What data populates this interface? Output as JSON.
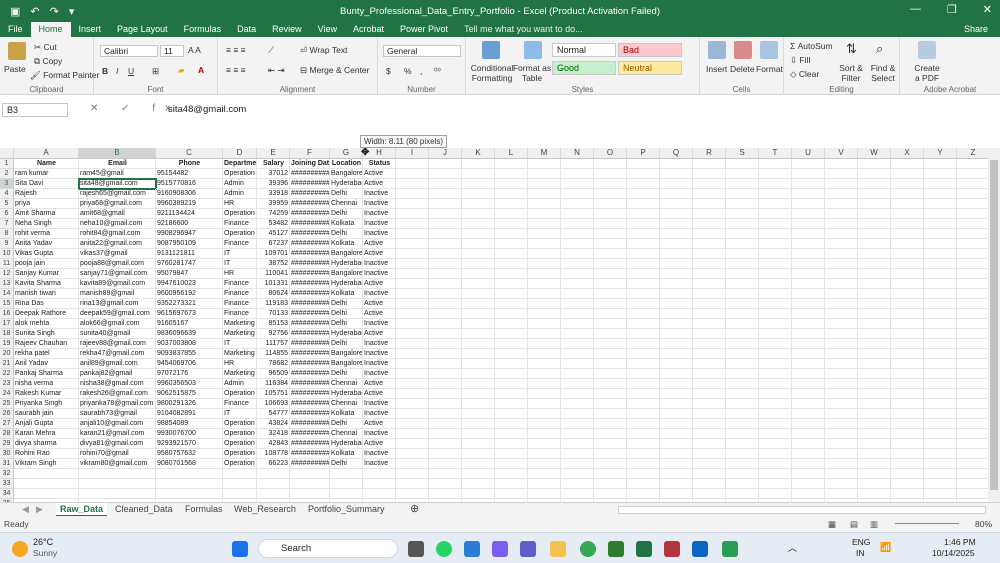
{
  "window": {
    "title": "Bunty_Professional_Data_Entry_Portfolio - Excel (Product Activation Failed)",
    "controls": [
      "—",
      "❐",
      "✕"
    ]
  },
  "menu": {
    "tabs": [
      "File",
      "Home",
      "Insert",
      "Page Layout",
      "Formulas",
      "Data",
      "Review",
      "View",
      "Acrobat",
      "Power Pivot"
    ],
    "search_text": "Tell me what you want to do...",
    "share": "Share"
  },
  "ribbon": {
    "clipboard": {
      "paste": "Paste",
      "cut": "Cut",
      "copy": "Copy",
      "format_painter": "Format Painter",
      "group": "Clipboard"
    },
    "font": {
      "name": "Calibri",
      "size": "11",
      "group": "Font",
      "bold": "B",
      "italic": "I",
      "underline": "U"
    },
    "alignment": {
      "wrap": "Wrap Text",
      "merge": "Merge & Center",
      "group": "Alignment"
    },
    "number": {
      "format": "General",
      "currency": "$",
      "percent": "%",
      "comma": ",",
      "group": "Number"
    },
    "styles": {
      "conditional": "Conditional Formatting",
      "table": "Format as Table",
      "normal": "Normal",
      "bad": "Bad",
      "good": "Good",
      "neutral": "Neutral",
      "group": "Styles"
    },
    "cells": {
      "insert": "Insert",
      "delete": "Delete",
      "format": "Format",
      "group": "Cells"
    },
    "editing": {
      "autosum": "AutoSum",
      "fill": "Fill",
      "clear": "Clear",
      "sort": "Sort & Filter",
      "find": "Find & Select",
      "group": "Editing"
    },
    "adobe": {
      "create": "Create a PDF",
      "group": "Adobe Acrobat"
    }
  },
  "formula_bar": {
    "name_box": "B3",
    "fx": "✕ ✓ fx",
    "value": "sita48@gmail.com"
  },
  "tooltip": "Width: 8.11 (80 pixels)",
  "sheet": {
    "columns": [
      "A",
      "B",
      "C",
      "D",
      "E",
      "F",
      "G",
      "H",
      "I",
      "J",
      "K",
      "L",
      "M",
      "N",
      "O",
      "P",
      "Q",
      "R",
      "S",
      "T",
      "U",
      "V",
      "W",
      "X",
      "Y",
      "Z"
    ],
    "headers": [
      "Name",
      "Email",
      "Phone",
      "Department",
      "Salary",
      "Joining Date",
      "Location",
      "Status"
    ],
    "rows": [
      [
        "ram kumar",
        "ram45@gmail",
        "95154482",
        "Operation",
        "37012",
        "##########",
        "Bangalore",
        "Active"
      ],
      [
        "Sita Davi",
        "sita48@gmail.com",
        "9515770816",
        "Admin",
        "39396",
        "##########",
        "Hyderabad",
        "Active"
      ],
      [
        "Rajesh",
        "rajesh65@gmail.com",
        "9160908306",
        "Admin",
        "33918",
        "##########",
        "Delhi",
        "Inactive"
      ],
      [
        "priya",
        "priya68@gmail.com",
        "9960389219",
        "HR",
        "39959",
        "##########",
        "Chennai",
        "Inactive"
      ],
      [
        "Amit Sharma",
        "amit68@gmail",
        "9211134424",
        "Operation",
        "74259",
        "##########",
        "Delhi",
        "Inactive"
      ],
      [
        "Neha Singh",
        "neha10@gmail.com",
        "92186600",
        "Finance",
        "53482",
        "##########",
        "Kolkata",
        "Inactive"
      ],
      [
        "rohit verma",
        "rohit84@gmail.com",
        "9908296947",
        "Operation",
        "45127",
        "##########",
        "Delhi",
        "Inactive"
      ],
      [
        "Anita Yadav",
        "anita22@gmail.com",
        "9087950109",
        "Finance",
        "67237",
        "##########",
        "Kolkata",
        "Active"
      ],
      [
        "Vikas Gupta",
        "vikas37@gmail",
        "9131121811",
        "IT",
        "109701",
        "##########",
        "Bangalore",
        "Active"
      ],
      [
        "pooja jain",
        "pooja88@gmail.com",
        "9760281747",
        "IT",
        "38752",
        "##########",
        "Hyderabad",
        "Inactive"
      ],
      [
        "Sanjay Kumar",
        "sanjay71@gmail.com",
        "95079847",
        "HR",
        "110041",
        "##########",
        "Bangalore",
        "Inactive"
      ],
      [
        "Kavita Sharma",
        "kavita89@gmail.com",
        "9947610023",
        "Finance",
        "101331",
        "##########",
        "Hyderabad",
        "Active"
      ],
      [
        "manish tiwari",
        "manish89@gmail",
        "9600956192",
        "Finance",
        "80624",
        "##########",
        "Kolkata",
        "Inactive"
      ],
      [
        "Rina Das",
        "rina13@gmail.com",
        "9352273321",
        "Finance",
        "119183",
        "##########",
        "Delhi",
        "Active"
      ],
      [
        "Deepak Rathore",
        "deepak59@gmail.com",
        "9615697673",
        "Finance",
        "70133",
        "##########",
        "Delhi",
        "Active"
      ],
      [
        "alok mehta",
        "alok66@gmail.com",
        "91605167",
        "Marketing",
        "85153",
        "##########",
        "Delhi",
        "Inactive"
      ],
      [
        "Sunita Singh",
        "sunita40@gmail",
        "9836096639",
        "Marketing",
        "92756",
        "##########",
        "Hyderabad",
        "Active"
      ],
      [
        "Rajeev Chauhan",
        "rajeev88@gmail.com",
        "9037003808",
        "IT",
        "111757",
        "##########",
        "Delhi",
        "Inactive"
      ],
      [
        "rekha patel",
        "rekha47@gmail.com",
        "9093837855",
        "Marketing",
        "114855",
        "##########",
        "Bangalore",
        "Inactive"
      ],
      [
        "Anil Yadav",
        "anil89@gmail.com",
        "9454069706",
        "HR",
        "78682",
        "##########",
        "Bangalore",
        "Inactive"
      ],
      [
        "Pankaj Sharma",
        "pankaj82@gmail",
        "97072176",
        "Marketing",
        "96509",
        "##########",
        "Delhi",
        "Inactive"
      ],
      [
        "nisha verma",
        "nisha38@gmail.com",
        "9960356503",
        "Admin",
        "116384",
        "##########",
        "Chennai",
        "Active"
      ],
      [
        "Rakesh Kumar",
        "rakesh26@gmail.com",
        "9062515875",
        "Operation",
        "105751",
        "##########",
        "Hyderabad",
        "Active"
      ],
      [
        "Priyanka Singh",
        "priyanka78@gmail.com",
        "9800291326",
        "Finance",
        "106693",
        "##########",
        "Chennai",
        "Inactive"
      ],
      [
        "saurabh jain",
        "saurabh73@gmail",
        "9104082891",
        "IT",
        "54777",
        "##########",
        "Kolkata",
        "Inactive"
      ],
      [
        "Anjali Gupta",
        "anjali10@gmail.com",
        "98854089",
        "Operation",
        "43824",
        "##########",
        "Delhi",
        "Active"
      ],
      [
        "Karan Mehra",
        "karan21@gmail.com",
        "9930076700",
        "Operation",
        "32418",
        "##########",
        "Chennai",
        "Inactive"
      ],
      [
        "divya sharma",
        "divya81@gmail.com",
        "9293921570",
        "Operation",
        "42843",
        "##########",
        "Hyderabad",
        "Active"
      ],
      [
        "Rohini Rao",
        "rohini70@gmail",
        "9580757632",
        "Operation",
        "108778",
        "##########",
        "Kolkata",
        "Inactive"
      ],
      [
        "Vikram Singh",
        "vikram80@gmail.com",
        "9080701568",
        "Operation",
        "66223",
        "##########",
        "Delhi",
        "Inactive"
      ]
    ],
    "row_numbers": [
      "1",
      "2",
      "3",
      "4",
      "5",
      "6",
      "7",
      "8",
      "9",
      "10",
      "11",
      "12",
      "13",
      "14",
      "15",
      "16",
      "17",
      "18",
      "19",
      "20",
      "21",
      "22",
      "23",
      "24",
      "25",
      "26",
      "27",
      "28",
      "29",
      "30",
      "31",
      "32",
      "33",
      "34",
      "35"
    ]
  },
  "sheet_tabs": [
    "Raw_Data",
    "Cleaned_Data",
    "Formulas",
    "Web_Research",
    "Portfolio_Summary"
  ],
  "status": {
    "mode": "Ready",
    "zoom": "80%"
  },
  "taskbar": {
    "temp": "26°C",
    "weather": "Sunny",
    "search": "Search",
    "lang1": "ENG",
    "lang2": "IN",
    "time": "1:46 PM",
    "date": "10/14/2025"
  }
}
